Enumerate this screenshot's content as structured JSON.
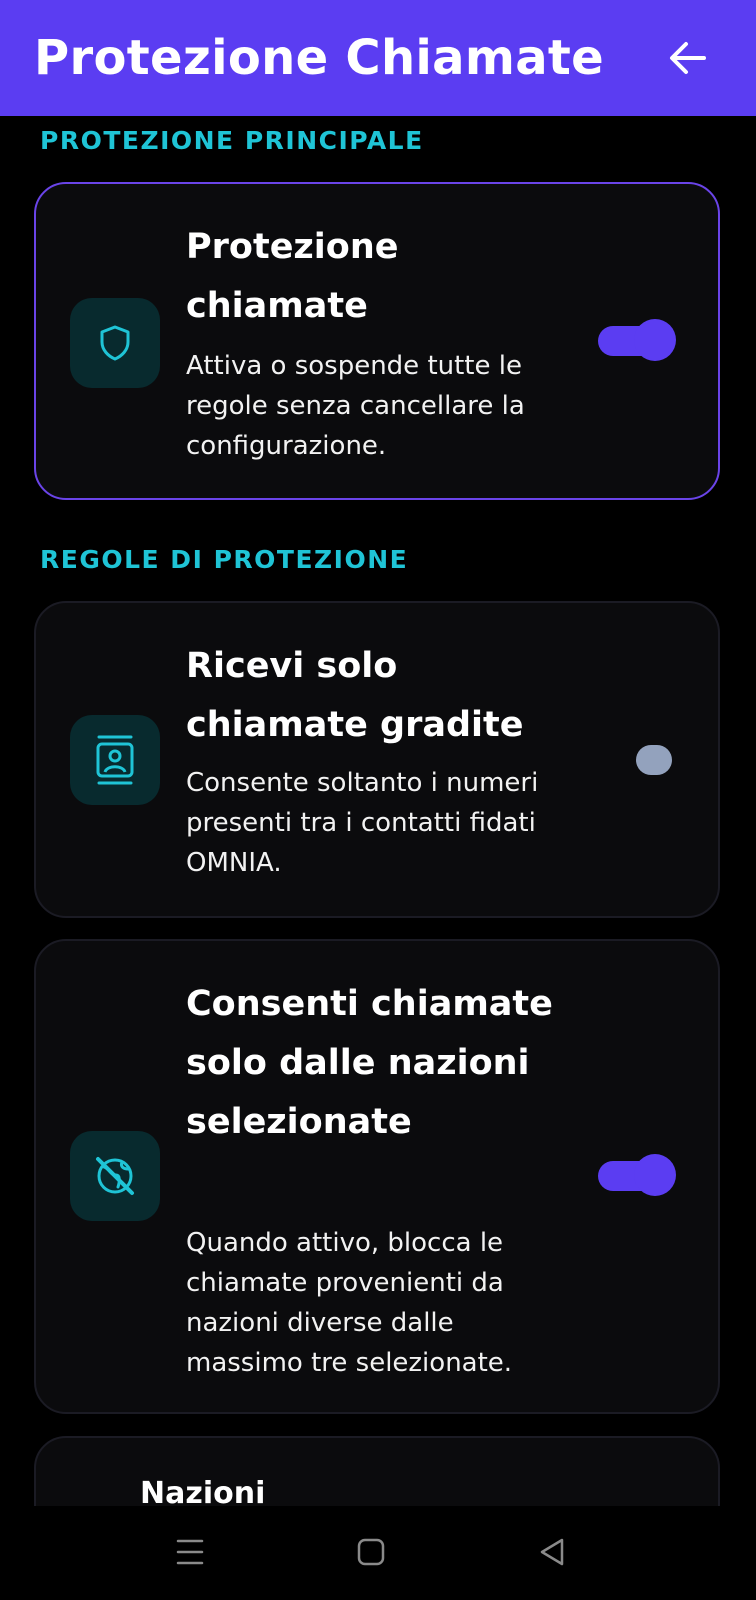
{
  "header": {
    "title": "Protezione Chiamate",
    "back_icon": "arrow-left-icon"
  },
  "sections": {
    "main_label": "PROTEZIONE PRINCIPALE",
    "rules_label": "REGOLE DI PROTEZIONE"
  },
  "cards": {
    "call_protection": {
      "title": "Protezione chiamate",
      "description": "Attiva o sospende tutte le regole senza cancellare la configurazione.",
      "icon": "shield-icon",
      "enabled": true
    },
    "only_wanted_calls": {
      "title": "Ricevi solo chiamate gradite",
      "description": "Consente soltanto i numeri presenti tra i contatti fidati OMNIA.",
      "icon": "contact-card-icon",
      "enabled": false
    },
    "selected_countries": {
      "title": "Consenti chiamate solo dalle nazioni selezionate",
      "description": "Quando attivo, blocca le chiamate provenienti da nazioni diverse dalle massimo tre selezionate.",
      "icon": "globe-blocked-icon",
      "enabled": true
    },
    "countries_partial": {
      "title": "Nazioni"
    }
  },
  "colors": {
    "accent": "#5b3df2",
    "section_label": "#1fc4d6",
    "highlight_border": "#6a44e8",
    "icon_bg": "#082a2e",
    "icon": "#1fc4d6",
    "toggle_off": "#93a2bd"
  },
  "navigation": {
    "recents_icon": "menu-lines-icon",
    "home_icon": "home-square-icon",
    "back_icon": "back-triangle-icon"
  }
}
